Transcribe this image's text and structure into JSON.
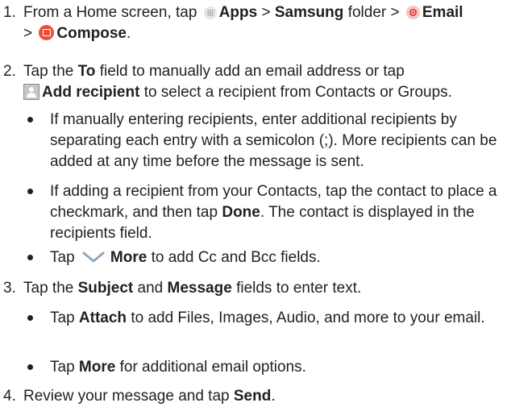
{
  "steps": [
    {
      "num": "1.",
      "line1": {
        "a": "From a Home screen, tap",
        "apps": "Apps",
        "sep1": ">",
        "samsung": "Samsung",
        "folder": "folder >",
        "email": "Email"
      },
      "line2": {
        "sep": ">",
        "compose": "Compose",
        "end": "."
      }
    },
    {
      "num": "2.",
      "line1": "Tap the",
      "to": "To",
      "line1b": "field to manually add an email address or tap",
      "add_recipient": "Add recipient",
      "line2b": "to select a recipient from Contacts or Groups.",
      "bullets": [
        {
          "text": "If manually entering recipients, enter additional recipients by separating each entry with a semicolon (;). More recipients can be added at any time before the message is sent."
        },
        {
          "a": "If adding a recipient from your Contacts, tap the contact to place a checkmark, and then tap",
          "done": "Done",
          "b": ". The contact is displayed in the recipients field."
        },
        {
          "a": "Tap",
          "more": "More",
          "b": "to add Cc and Bcc fields."
        }
      ]
    },
    {
      "num": "3.",
      "a": "Tap the",
      "subject": "Subject",
      "and": "and",
      "message": "Message",
      "b": "fields to enter text.",
      "bullets": [
        {
          "a": "Tap",
          "attach": "Attach",
          "b": "to add Files, Images, Audio, and more to your email."
        },
        {
          "a": "Tap",
          "more": "More",
          "b": "for additional email options."
        }
      ]
    },
    {
      "num": "4.",
      "a": "Review your message and tap",
      "send": "Send",
      "end": "."
    }
  ],
  "icons": {
    "apps": "apps-grid-icon",
    "email": "email-app-icon",
    "compose": "compose-icon",
    "add_recipient": "add-recipient-icon",
    "more": "chevron-down-icon"
  },
  "colors": {
    "text": "#231f20",
    "email_icon": "#e03a32",
    "compose_icon": "#e8503a",
    "chevron": "#8ea9c1"
  }
}
